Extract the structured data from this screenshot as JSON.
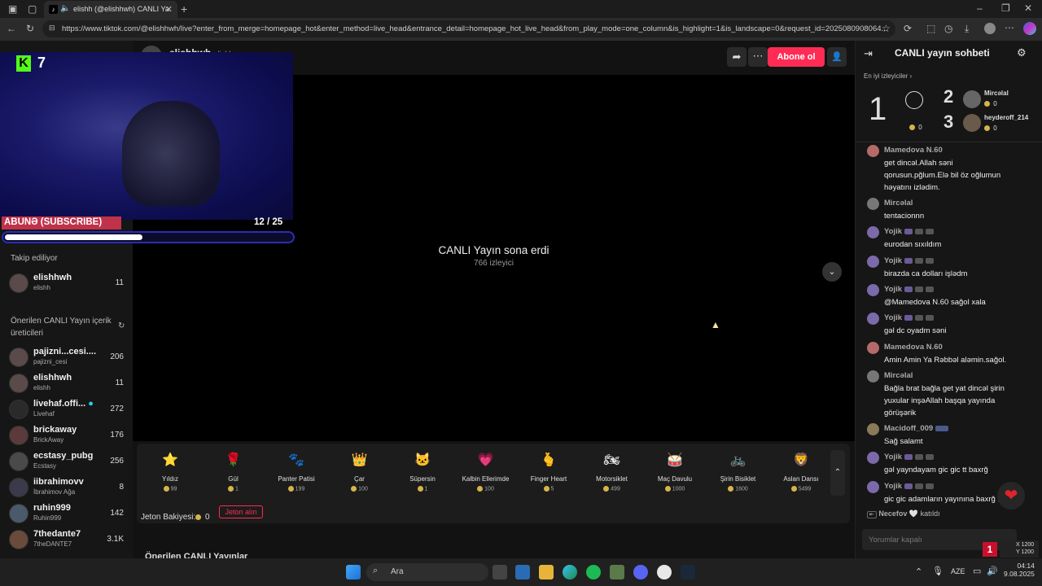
{
  "browser": {
    "tab_title": "elishh (@elishhwh) CANLI Ya",
    "url": "https://www.tiktok.com/@elishhwh/live?enter_from_merge=homepage_hot&enter_method=live_head&entrance_detail=homepage_hot_live_head&from_play_mode=one_column&is_highlight=1&is_landscape=0&request_id=2025080908064..."
  },
  "overlay": {
    "kick_count": "7",
    "subscribe_label": "ABUNƏ (SUBSCRIBE)",
    "goal_text": "12  / 25",
    "goal_progress": 0.48
  },
  "sidebar": {
    "following_label": "Takip ediliyor",
    "following": [
      {
        "name": "elishhwh",
        "handle": "elishh",
        "count": "11"
      }
    ],
    "suggested_label": "Önerilen CANLI Yayın içerik üreticileri",
    "suggested": [
      {
        "name": "pajizni...cesi....",
        "handle": "pajizni_cesi",
        "count": "206"
      },
      {
        "name": "elishhwh",
        "handle": "elishh",
        "count": "11"
      },
      {
        "name": "livehaf.offi...",
        "handle": "Livehaf",
        "count": "272"
      },
      {
        "name": "brickaway",
        "handle": "BrickAway",
        "count": "176"
      },
      {
        "name": "ecstasy_pubg",
        "handle": "Ecstasy",
        "count": "256"
      },
      {
        "name": "iibrahimovv",
        "handle": "İbrahimov Ağa",
        "count": "8"
      },
      {
        "name": "ruhin999",
        "handle": "Ruhin999",
        "count": "142"
      },
      {
        "name": "7thedante7",
        "handle": "7theDANTE7",
        "count": "3.1K"
      }
    ]
  },
  "header": {
    "streamer": "elishhwh",
    "streamer_sub": "elishh",
    "follow_label": "Abone ol"
  },
  "player": {
    "ended_title": "CANLI Yayın sona erdi",
    "viewers": "766 izleyici"
  },
  "gifts": [
    {
      "name": "Yıldız",
      "price": "99",
      "icon": "⭐"
    },
    {
      "name": "Gül",
      "price": "1",
      "icon": "🌹"
    },
    {
      "name": "Panter Patisi",
      "price": "199",
      "icon": "🐾"
    },
    {
      "name": "Çar",
      "price": "100",
      "icon": "👑"
    },
    {
      "name": "Süpersin",
      "price": "1",
      "icon": "🐱"
    },
    {
      "name": "Kalbin Ellerimde",
      "price": "100",
      "icon": "💗"
    },
    {
      "name": "Finger Heart",
      "price": "5",
      "icon": "🫰"
    },
    {
      "name": "Motorsiklet",
      "price": "499",
      "icon": "🏍"
    },
    {
      "name": "Maç Davulu",
      "price": "1000",
      "icon": "🥁"
    },
    {
      "name": "Şirin Bisiklet",
      "price": "1600",
      "icon": "🚲"
    },
    {
      "name": "Aslan Dansı",
      "price": "5499",
      "icon": "🦁"
    }
  ],
  "wallet": {
    "balance_label": "Jeton Bakiyesi:",
    "balance": "0",
    "get_coins": "Jeton alın"
  },
  "below_player": "Önerilen CANLI Yayınlar",
  "chat": {
    "title": "CANLI yayın sohbeti",
    "top_viewers_label": "En iyi izleyiciler",
    "rank1": {
      "rank": "1",
      "points": "0"
    },
    "rank2": {
      "rank": "2",
      "name": "Mircəlal",
      "points": "0"
    },
    "rank3": {
      "rank": "3",
      "name": "heyderoff_214",
      "points": "0"
    },
    "messages": [
      {
        "user": "Mamedova N.60",
        "text": "get dincəl.Allah səni qorusun.pğlum.Elə bil öz oğlumun həyatını izlədim."
      },
      {
        "user": "Mircəlal",
        "text": "tentacionnn"
      },
      {
        "user": "Yojik",
        "text": "eurodan sıxıldım"
      },
      {
        "user": "Yojik",
        "text": "birazda ca dolları işlədm"
      },
      {
        "user": "Yojik",
        "text": "@Mamedova N.60 sağol xala"
      },
      {
        "user": "Yojik",
        "text": "gəl dc oyadm səni"
      },
      {
        "user": "Mamedova N.60",
        "text": "Amin Amin Ya Rəbbəl aləmin.sağol."
      },
      {
        "user": "Mircəlal",
        "text": "Bağla brat bağla get yat dincəl şirin yuxular inşəAllah başqa yayında görüşərik"
      },
      {
        "user": "Macidoff_009",
        "text": "Sağ salamt"
      },
      {
        "user": "Yojik",
        "text": "gəl yayndayam gic gic tt baxrğ"
      },
      {
        "user": "Yojik",
        "text": "gic gic adamların yayınına baxrğ :D"
      }
    ],
    "join_user": "Necefov",
    "join_text": "katıldı",
    "input_placeholder": "Yorumlar kapalı"
  },
  "taskbar": {
    "search_placeholder": "Ara",
    "lang": "AZE",
    "time": "04:14",
    "date": "9.08.2025",
    "cursor_x": "X 1200",
    "cursor_y": "Y 1200"
  },
  "colors": {
    "accent": "#fe2c55",
    "background": "#121212",
    "kick_green": "#53fc18"
  }
}
